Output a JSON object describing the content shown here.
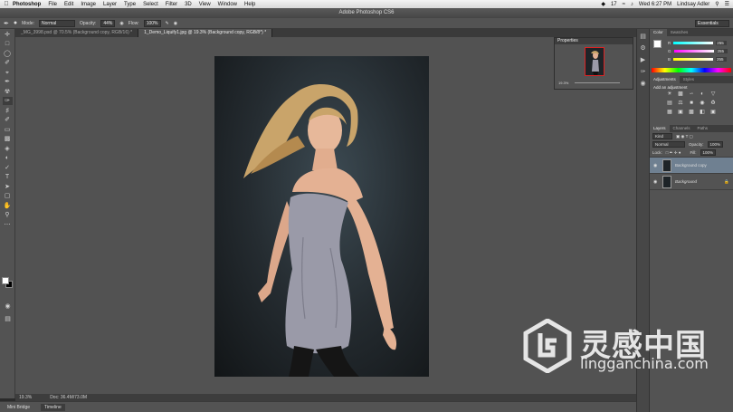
{
  "menubar": {
    "app": "Photoshop",
    "items": [
      "File",
      "Edit",
      "Image",
      "Layer",
      "Type",
      "Select",
      "Filter",
      "3D",
      "View",
      "Window",
      "Help"
    ],
    "clock": "Wed 6:27 PM",
    "user": "Lindsay Adler",
    "battery": "17"
  },
  "window": {
    "title": "Adobe Photoshop CS6"
  },
  "options": {
    "mode_label": "Mode:",
    "mode_value": "Normal",
    "opacity_label": "Opacity:",
    "opacity_value": "44%",
    "flow_label": "Flow:",
    "flow_value": "100%",
    "workspace": "Essentials"
  },
  "tabs": [
    {
      "label": "_MG_3998.psd @ 70.5% (Background copy, RGB/16) *",
      "active": false
    },
    {
      "label": "1_Demo_Liquify1.jpg @ 19.3% (Background copy, RGB/8*) *",
      "active": true
    }
  ],
  "properties": {
    "title": "Properties",
    "zoom": "19.3%"
  },
  "color_panel": {
    "tabs": [
      "Color",
      "Swatches"
    ],
    "r_label": "R",
    "r_value": "255",
    "g_label": "G",
    "g_value": "255",
    "b_label": "B",
    "b_value": "255"
  },
  "adjustments": {
    "tabs": [
      "Adjustments",
      "Styles"
    ],
    "header": "Add an adjustment"
  },
  "layers_panel": {
    "tabs": [
      "Layers",
      "Channels",
      "Paths"
    ],
    "kind": "Kind",
    "blend": "Normal",
    "opacity_label": "Opacity:",
    "opacity_value": "100%",
    "lock_label": "Lock:",
    "fill_label": "Fill:",
    "fill_value": "100%",
    "layers": [
      {
        "name": "Background copy",
        "selected": true
      },
      {
        "name": "Background",
        "selected": false
      }
    ]
  },
  "status": {
    "zoom": "19.3%",
    "doc": "Doc: 36.4M/73.0M"
  },
  "bottom_tabs": [
    "Mini Bridge",
    "Timeline"
  ],
  "watermark": {
    "chinese": "灵感中国",
    "url": "lingganchina.com"
  }
}
